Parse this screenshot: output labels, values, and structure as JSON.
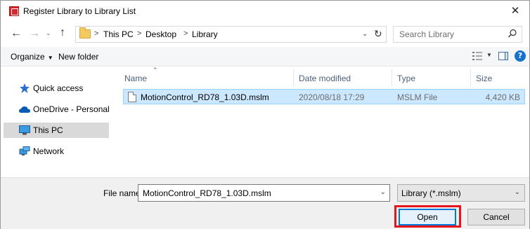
{
  "window": {
    "title": "Register Library to Library List",
    "close_glyph": "✕"
  },
  "address_bar": {
    "breadcrumbs": [
      "This PC",
      "Desktop",
      "Library"
    ],
    "separator": ">",
    "search_placeholder": "Search Library"
  },
  "toolbar": {
    "organize_label": "Organize",
    "new_folder_label": "New folder",
    "help_glyph": "?"
  },
  "nav_pane": {
    "items": [
      {
        "label": "Quick access",
        "icon": "star-icon",
        "selected": false
      },
      {
        "label": "OneDrive - Personal",
        "icon": "cloud-icon",
        "selected": false
      },
      {
        "label": "This PC",
        "icon": "monitor-icon",
        "selected": true
      },
      {
        "label": "Network",
        "icon": "network-icon",
        "selected": false
      }
    ]
  },
  "file_list": {
    "columns": [
      "Name",
      "Date modified",
      "Type",
      "Size"
    ],
    "sort_column": "Name",
    "rows": [
      {
        "name": "MotionControl_RD78_1.03D.mslm",
        "date_modified": "2020/08/18 17:29",
        "type": "MSLM File",
        "size": "4,420 KB",
        "selected": true
      }
    ]
  },
  "footer": {
    "file_name_label": "File name:",
    "file_name_value": "MotionControl_RD78_1.03D.mslm",
    "file_type_value": "Library (*.mslm)",
    "open_label": "Open",
    "cancel_label": "Cancel"
  },
  "colors": {
    "selection_bg": "#cce8ff",
    "selection_border": "#99d1ff",
    "primary_button_border": "#0078d7",
    "highlight_box": "#e8141c",
    "app_icon": "#d9262c"
  }
}
